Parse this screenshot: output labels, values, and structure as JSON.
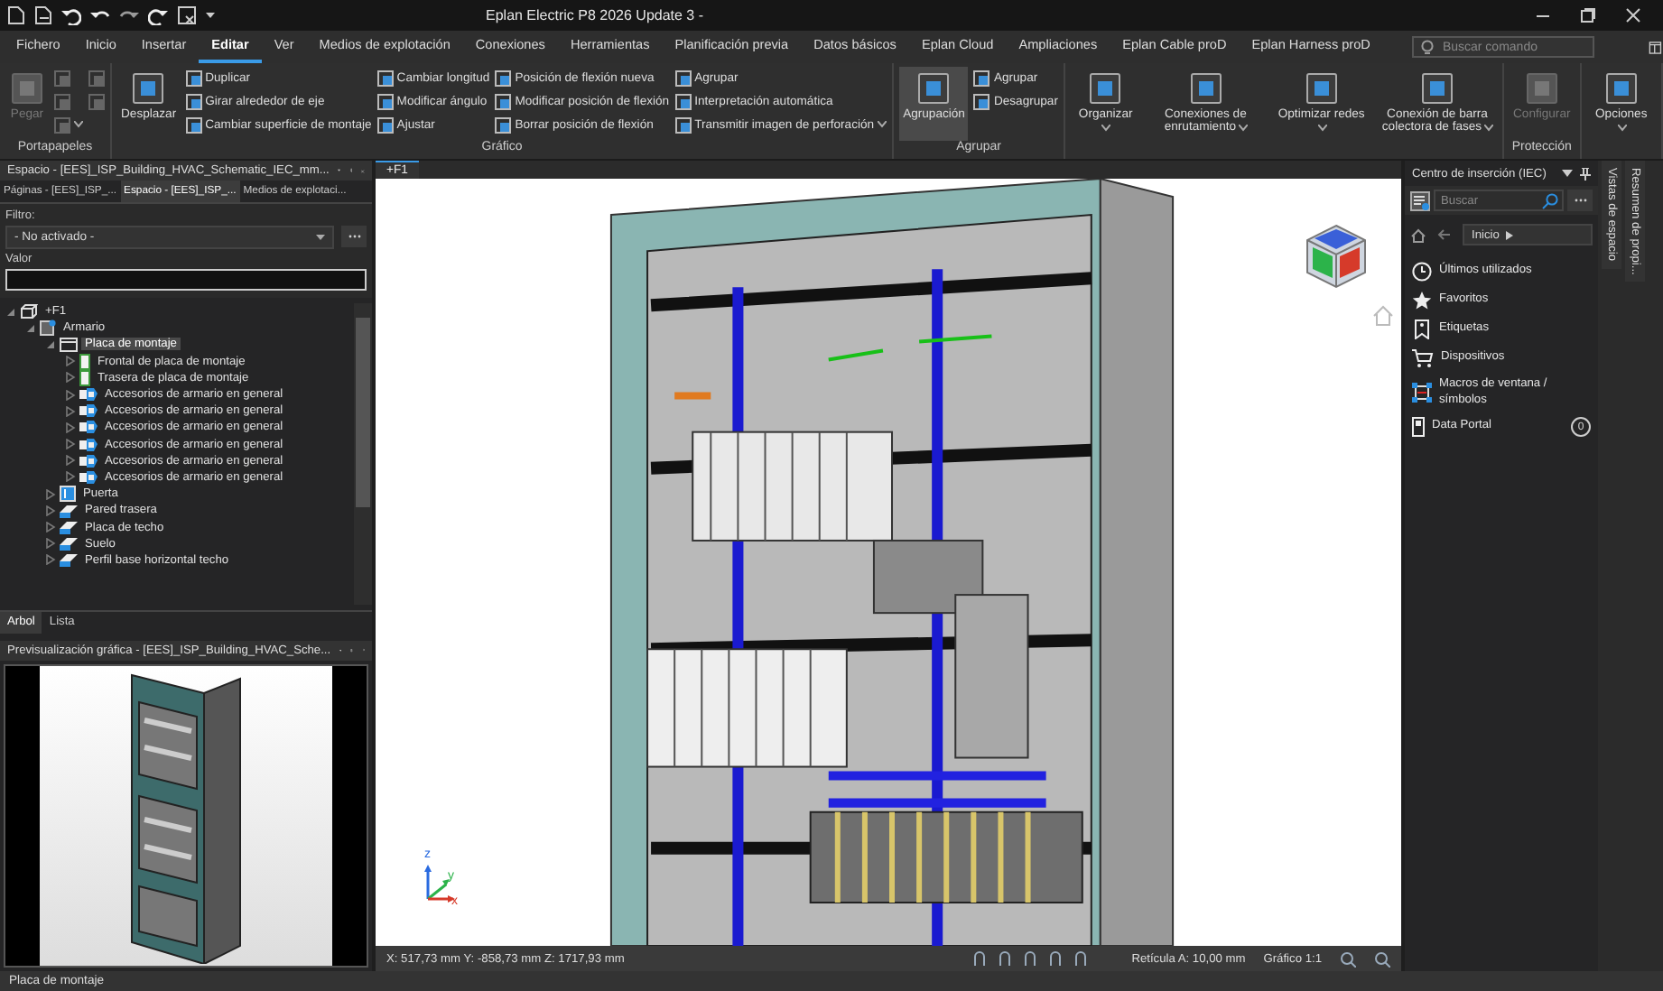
{
  "window": {
    "title": "Eplan Electric P8 2026 Update 3 -"
  },
  "menu_tabs": [
    {
      "label": "Fichero",
      "selected": false
    },
    {
      "label": "Inicio",
      "selected": false
    },
    {
      "label": "Insertar",
      "selected": false
    },
    {
      "label": "Editar",
      "selected": true
    },
    {
      "label": "Ver",
      "selected": false
    },
    {
      "label": "Medios de explotación",
      "selected": false
    },
    {
      "label": "Conexiones",
      "selected": false
    },
    {
      "label": "Herramientas",
      "selected": false
    },
    {
      "label": "Planificación previa",
      "selected": false
    },
    {
      "label": "Datos básicos",
      "selected": false
    },
    {
      "label": "Eplan Cloud",
      "selected": false
    },
    {
      "label": "Ampliaciones",
      "selected": false
    },
    {
      "label": "Eplan Cable proD",
      "selected": false
    },
    {
      "label": "Eplan Harness proD",
      "selected": false
    }
  ],
  "search": {
    "placeholder": "Buscar comando"
  },
  "ribbon": [
    {
      "label": "Portapapeles",
      "large": [
        {
          "label": "Pegar",
          "disabled": true,
          "dropdown": false,
          "selected": false
        }
      ],
      "columns": [
        [
          {
            "kind": "icon",
            "disabled": true,
            "dropdown": false
          },
          {
            "kind": "icon",
            "disabled": true,
            "dropdown": false
          },
          {
            "kind": "icon",
            "disabled": true,
            "dropdown": true
          }
        ],
        [
          {
            "kind": "icon",
            "disabled": true,
            "dropdown": false
          },
          {
            "kind": "icon",
            "disabled": true,
            "dropdown": false
          }
        ]
      ]
    },
    {
      "label": "Gráfico",
      "large": [
        {
          "label": "Desplazar",
          "disabled": false,
          "dropdown": false,
          "selected": false
        }
      ],
      "columns": [
        [
          {
            "kind": "text",
            "label": "Duplicar",
            "disabled": false,
            "dropdown": false
          },
          {
            "kind": "text",
            "label": "Girar alrededor de eje",
            "disabled": false,
            "dropdown": false
          },
          {
            "kind": "text",
            "label": "Cambiar superficie de montaje",
            "disabled": false,
            "dropdown": false
          }
        ],
        [
          {
            "kind": "text",
            "label": "Cambiar longitud",
            "disabled": false,
            "dropdown": false
          },
          {
            "kind": "text",
            "label": "Modificar ángulo",
            "disabled": false,
            "dropdown": false
          },
          {
            "kind": "text",
            "label": "Ajustar",
            "disabled": false,
            "dropdown": false
          }
        ],
        [
          {
            "kind": "text",
            "label": "Posición de flexión nueva",
            "disabled": false,
            "dropdown": false
          },
          {
            "kind": "text",
            "label": "Modificar posición de flexión",
            "disabled": false,
            "dropdown": false
          },
          {
            "kind": "text",
            "label": "Borrar posición de flexión",
            "disabled": false,
            "dropdown": false
          }
        ],
        [
          {
            "kind": "text",
            "label": "Agrupar",
            "disabled": false,
            "dropdown": false
          },
          {
            "kind": "text",
            "label": "Interpretación automática",
            "disabled": false,
            "dropdown": false
          },
          {
            "kind": "text",
            "label": "Transmitir imagen de perforación",
            "disabled": false,
            "dropdown": true
          }
        ]
      ]
    },
    {
      "label": "Agrupar",
      "large": [
        {
          "label": "Agrupación",
          "disabled": false,
          "dropdown": false,
          "selected": true
        }
      ],
      "columns": [
        [
          {
            "kind": "text",
            "label": "Agrupar",
            "disabled": false,
            "dropdown": false
          },
          {
            "kind": "text",
            "label": "Desagrupar",
            "disabled": false,
            "dropdown": false
          }
        ]
      ]
    },
    {
      "large": [
        {
          "label": "Organizar",
          "disabled": false,
          "dropdown": true,
          "selected": false
        },
        {
          "label": "Conexiones de enrutamiento",
          "disabled": false,
          "dropdown": true,
          "selected": false
        },
        {
          "label": "Optimizar redes",
          "disabled": false,
          "dropdown": true,
          "selected": false
        },
        {
          "label": "Conexión de barra colectora de fases",
          "disabled": false,
          "dropdown": true,
          "selected": false
        }
      ]
    },
    {
      "label": "Protección",
      "large": [
        {
          "label": "Configurar",
          "disabled": true,
          "dropdown": false,
          "selected": false
        }
      ]
    },
    {
      "large": [
        {
          "label": "Opciones",
          "disabled": false,
          "dropdown": true,
          "selected": false
        }
      ]
    }
  ],
  "left_panel": {
    "title": "Espacio - [EES]_ISP_Building_HVAC_Schematic_IEC_mm...",
    "tabs": [
      {
        "label": "Páginas - [EES]_ISP_...",
        "selected": false
      },
      {
        "label": "Espacio - [EES]_ISP_...",
        "selected": true
      },
      {
        "label": "Medios de explotaci...",
        "selected": false
      }
    ],
    "filter": {
      "label": "Filtro:",
      "value": "- No activado -"
    },
    "value_field": {
      "label": "Valor"
    },
    "tree": [
      {
        "label": "+F1",
        "kind": "location",
        "expanded": true,
        "selected": false,
        "children": [
          {
            "label": "Armario",
            "kind": "cabinet",
            "expanded": true,
            "selected": false,
            "children": [
              {
                "label": "Placa de montaje",
                "kind": "plate",
                "expanded": true,
                "selected": true,
                "children": [
                  {
                    "label": "Frontal de placa de montaje",
                    "kind": "plate-side",
                    "expanded": false,
                    "selected": false
                  },
                  {
                    "label": "Trasera de placa de montaje",
                    "kind": "plate-side",
                    "expanded": false,
                    "selected": false
                  },
                  {
                    "label": "Accesorios de armario en general",
                    "kind": "accessory",
                    "expanded": false,
                    "selected": false
                  },
                  {
                    "label": "Accesorios de armario en general",
                    "kind": "accessory",
                    "expanded": false,
                    "selected": false
                  },
                  {
                    "label": "Accesorios de armario en general",
                    "kind": "accessory",
                    "expanded": false,
                    "selected": false
                  },
                  {
                    "label": "Accesorios de armario en general",
                    "kind": "accessory",
                    "expanded": false,
                    "selected": false
                  },
                  {
                    "label": "Accesorios de armario en general",
                    "kind": "accessory",
                    "expanded": false,
                    "selected": false
                  },
                  {
                    "label": "Accesorios de armario en general",
                    "kind": "accessory",
                    "expanded": false,
                    "selected": false
                  }
                ]
              },
              {
                "label": "Puerta",
                "kind": "door",
                "expanded": false,
                "selected": false
              },
              {
                "label": "Pared trasera",
                "kind": "wall",
                "expanded": false,
                "selected": false
              },
              {
                "label": "Placa de techo",
                "kind": "wall",
                "expanded": false,
                "selected": false
              },
              {
                "label": "Suelo",
                "kind": "wall",
                "expanded": false,
                "selected": false
              },
              {
                "label": "Perfil base horizontal techo",
                "kind": "wall",
                "expanded": false,
                "selected": false
              }
            ]
          }
        ]
      }
    ],
    "bottom_tabs": [
      {
        "label": "Arbol",
        "selected": true
      },
      {
        "label": "Lista",
        "selected": false
      }
    ]
  },
  "preview_panel": {
    "title": "Previsualización gráfica - [EES]_ISP_Building_HVAC_Sche..."
  },
  "viewport": {
    "tab": "+F1",
    "axes": [
      "z",
      "y",
      "x"
    ],
    "coordinates": "X: 517,73 mm Y: -858,73 mm Z: 1717,93 mm",
    "grid": "Retícula A: 10,00 mm",
    "scale": "Gráfico 1:1"
  },
  "insertion_center": {
    "title": "Centro de inserción (IEC)",
    "search_placeholder": "Buscar",
    "breadcrumb": "Inicio",
    "items": [
      {
        "label": "Últimos utilizados"
      },
      {
        "label": "Favoritos"
      },
      {
        "label": "Etiquetas"
      },
      {
        "label": "Dispositivos"
      },
      {
        "label": "Macros de ventana / símbolos"
      },
      {
        "label": "Data Portal",
        "count": "0"
      }
    ]
  },
  "side_tabs": [
    "Vistas de espacio",
    "Resumen de propi..."
  ],
  "status_bar": {
    "text": "Placa de montaje"
  }
}
